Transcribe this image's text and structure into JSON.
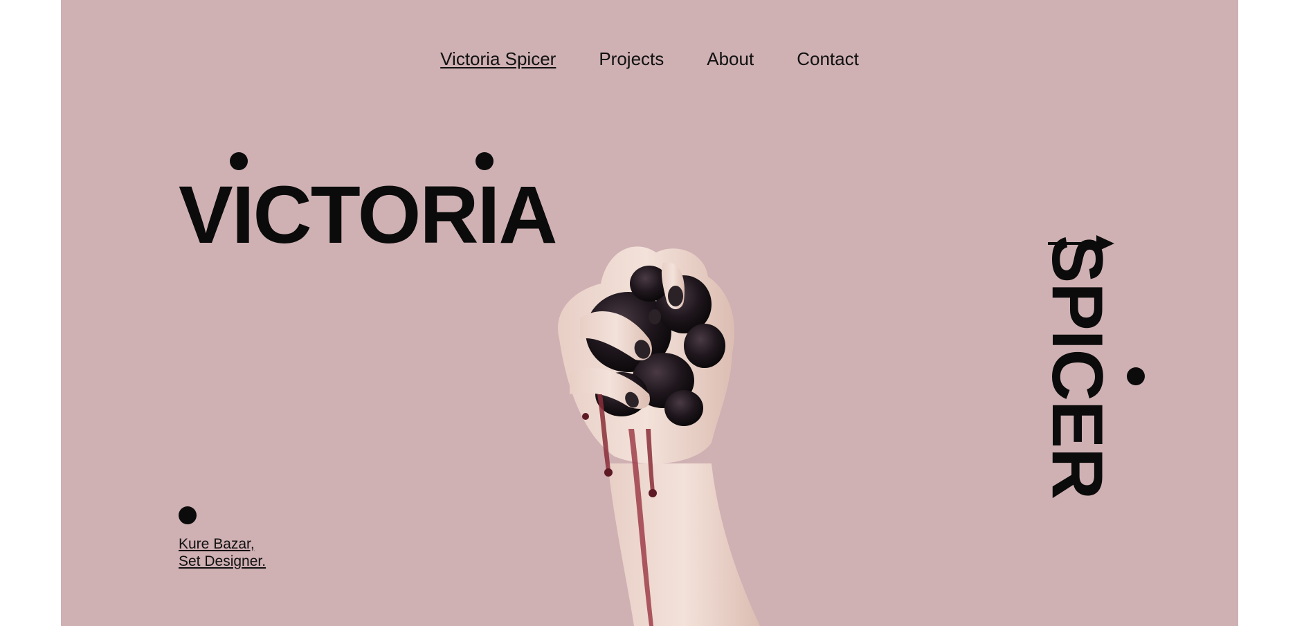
{
  "nav": {
    "items": [
      {
        "label": "Victoria Spicer",
        "active": true
      },
      {
        "label": "Projects",
        "active": false
      },
      {
        "label": "About",
        "active": false
      },
      {
        "label": "Contact",
        "active": false
      }
    ]
  },
  "hero": {
    "first_name": "VICTORIA",
    "last_name": "SPICER",
    "image_alt_icon": "hand-with-blackberries-image"
  },
  "caption": {
    "line1": "Kure Bazar,",
    "line2": "Set Designer."
  },
  "colors": {
    "background": "#cfb0b3",
    "text": "#0b0b0b",
    "page_outer": "#ffffff"
  }
}
